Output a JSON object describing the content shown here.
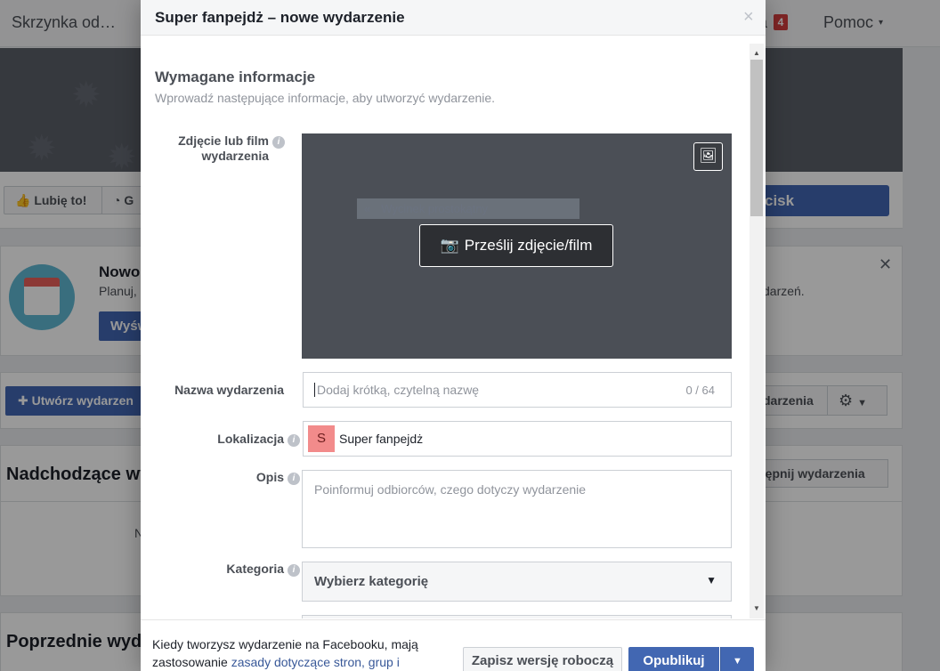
{
  "background": {
    "topbar": {
      "inbox_label": "Skrzynka od…",
      "partial_label": "a",
      "notification_count": "4",
      "help_label": "Pomoc",
      "help_caret": "▾"
    },
    "actions": {
      "like_label": "Lubię to!",
      "follow_partial": "G",
      "cta_partial": "cisk"
    },
    "promo": {
      "title_partial": "Nowo",
      "subtitle_partial": "Planuj,",
      "subtitle_end": "darzeń.",
      "button_partial": "Wyśw",
      "close_glyph": "✕"
    },
    "tools": {
      "create_label": "Utwórz wydarzen",
      "partial_label": "darzenia"
    },
    "upcoming": {
      "heading_partial": "Nadchodzące wy",
      "button_partial": "tępnij wydarzenia",
      "body_partial": "N"
    },
    "past": {
      "heading_partial": "Poprzednie wyd"
    }
  },
  "dialog": {
    "title": "Super fanpejdż – nowe wydarzenie",
    "close_glyph": "×",
    "section": {
      "title": "Wymagane informacje",
      "subtitle": "Wprowadź następujące informacje, aby utworzyć wydarzenie."
    },
    "photo": {
      "label_line1": "Zdjęcie lub film",
      "label_line2": "wydarzenia",
      "crop_hint": "Wycinek prostokątny",
      "upload_label": "Prześlij zdjęcie/film"
    },
    "name": {
      "label": "Nazwa wydarzenia",
      "placeholder": "Dodaj krótką, czytelną nazwę",
      "counter": "0 / 64"
    },
    "location": {
      "label": "Lokalizacja",
      "tag_letter": "S",
      "value": "Super fanpejdż"
    },
    "description": {
      "label": "Opis",
      "placeholder": "Poinformuj odbiorców, czego dotyczy wydarzenie"
    },
    "category": {
      "label": "Kategoria",
      "value": "Wybierz kategorię",
      "caret": "▼"
    },
    "footer": {
      "note_prefix": "Kiedy tworzysz wydarzenie na Facebooku, mają zastosowanie ",
      "note_link": "zasady dotyczące stron, grup i",
      "draft_label": "Zapisz wersję roboczą",
      "publish_label": "Opublikuj",
      "publish_menu_caret": "▼"
    }
  },
  "colors": {
    "accent": "#4267b2",
    "overlay": "rgba(0,0,0,0.4)",
    "location_tag": "#f28b8b"
  }
}
